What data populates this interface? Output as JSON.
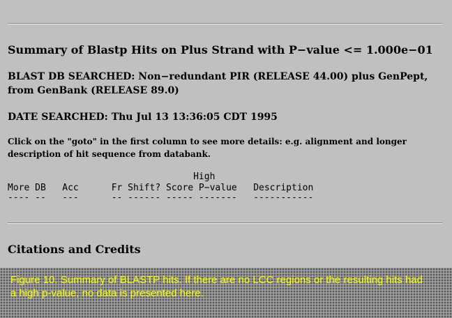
{
  "summary": {
    "title": "Summary of Blastp Hits on Plus Strand with P−value <= 1.000e−01",
    "db_searched_label": "BLAST DB SEARCHED",
    "db_searched_value": ": Non−redundant PIR (RELEASE 44.00) plus GenPept, from GenBank (RELEASE 89.0)",
    "date_searched_label": "DATE SEARCHED",
    "date_searched_value": ": Thu Jul 13 13:36:05 CDT 1995",
    "instructions": "Click on the \"goto\" in the first column to see more details: e.g. alignment and longer description of hit sequence from databank."
  },
  "table": {
    "header_line_1": "                                  High",
    "header_line_2": "More DB   Acc      Fr Shift? Score P−value   Description",
    "separator_line": "---- --   ---      -- ------ ----- -------   -----------"
  },
  "citations": {
    "heading": "Citations and Credits"
  },
  "caption": {
    "text": "Figure 10. Summary of BLASTP hits. If there are no LCC regions or the resulting hits had a high p-value, no data is presented here."
  }
}
